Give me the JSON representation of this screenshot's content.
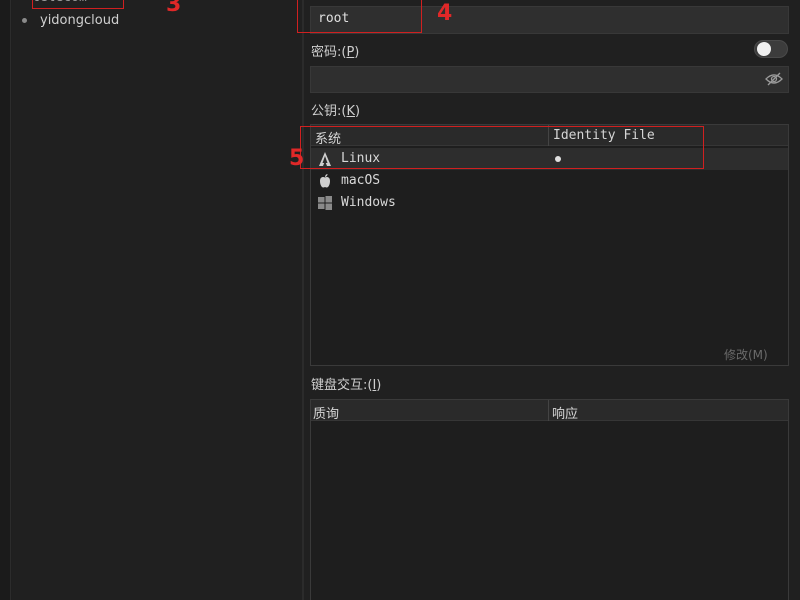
{
  "sidebar": {
    "items": [
      {
        "label": "yidongcloud"
      }
    ],
    "partial_item": {
      "label": "telecom"
    }
  },
  "form": {
    "username": {
      "value": "root"
    },
    "password": {
      "label": "密码:(",
      "mnemonic": "P",
      "label_end": ")",
      "toggle_on": false
    },
    "public_key": {
      "label": "公钥:(",
      "mnemonic": "K",
      "label_end": ")",
      "columns": [
        "系统",
        "Identity File"
      ],
      "rows": [
        {
          "os": "Linux",
          "icon": "linux-icon",
          "has_identity": true
        },
        {
          "os": "macOS",
          "icon": "apple-icon",
          "has_identity": false
        },
        {
          "os": "Windows",
          "icon": "windows-icon",
          "has_identity": false
        }
      ],
      "modify_button": "修改(M)"
    },
    "keyboard_interactive": {
      "label": "键盘交互:(",
      "mnemonic": "I",
      "label_end": ")",
      "columns": [
        "质询",
        "响应"
      ]
    }
  },
  "annotations": {
    "n3": "3",
    "n4": "4",
    "n5": "5"
  },
  "colors": {
    "annotation": "#d02020",
    "background": "#1f1f1f",
    "field": "#2f2f2f"
  }
}
